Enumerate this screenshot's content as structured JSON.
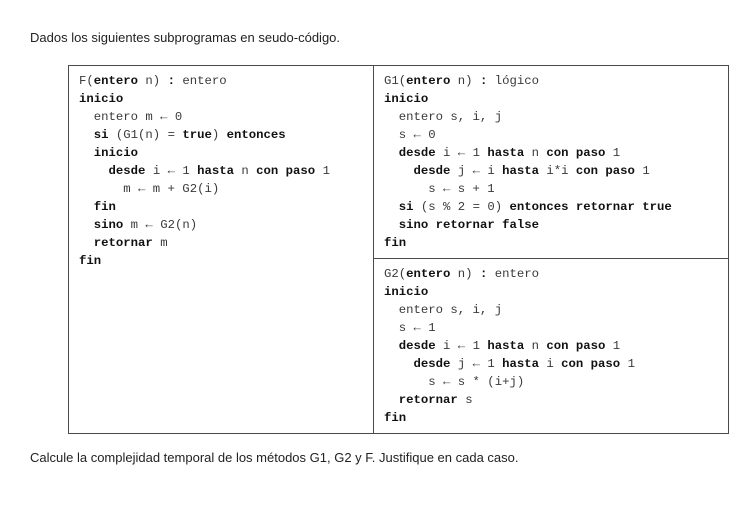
{
  "intro": "Dados los siguientes subprogramas en seudo-código.",
  "outro": "Calcule la complejidad temporal de los métodos G1, G2 y F. Justifique en cada caso.",
  "cells": {
    "F": {
      "lines": [
        [
          [
            "p",
            "F("
          ],
          [
            "b",
            "entero"
          ],
          [
            "p",
            " n) "
          ],
          [
            "b",
            ":"
          ],
          [
            "p",
            " entero"
          ]
        ],
        [
          [
            "b",
            "inicio"
          ]
        ],
        [
          [
            "p",
            "  entero m ← 0"
          ]
        ],
        [
          [
            "p",
            "  "
          ],
          [
            "b",
            "si"
          ],
          [
            "p",
            " (G1(n) = "
          ],
          [
            "b",
            "true"
          ],
          [
            "p",
            ") "
          ],
          [
            "b",
            "entonces"
          ]
        ],
        [
          [
            "p",
            "  "
          ],
          [
            "b",
            "inicio"
          ]
        ],
        [
          [
            "p",
            "    "
          ],
          [
            "b",
            "desde"
          ],
          [
            "p",
            " i ← 1 "
          ],
          [
            "b",
            "hasta"
          ],
          [
            "p",
            " n "
          ],
          [
            "b",
            "con paso"
          ],
          [
            "p",
            " 1"
          ]
        ],
        [
          [
            "p",
            "      m ← m + G2(i)"
          ]
        ],
        [
          [
            "p",
            "  "
          ],
          [
            "b",
            "fin"
          ]
        ],
        [
          [
            "p",
            "  "
          ],
          [
            "b",
            "sino"
          ],
          [
            "p",
            " m ← G2(n)"
          ]
        ],
        [
          [
            "p",
            "  "
          ],
          [
            "b",
            "retornar"
          ],
          [
            "p",
            " m"
          ]
        ],
        [
          [
            "b",
            "fin"
          ]
        ]
      ]
    },
    "G1": {
      "lines": [
        [
          [
            "p",
            "G1("
          ],
          [
            "b",
            "entero"
          ],
          [
            "p",
            " n) "
          ],
          [
            "b",
            ":"
          ],
          [
            "p",
            " lógico"
          ]
        ],
        [
          [
            "b",
            "inicio"
          ]
        ],
        [
          [
            "p",
            "  entero s, i, j"
          ]
        ],
        [
          [
            "p",
            "  s ← 0"
          ]
        ],
        [
          [
            "p",
            "  "
          ],
          [
            "b",
            "desde"
          ],
          [
            "p",
            " i ← 1 "
          ],
          [
            "b",
            "hasta"
          ],
          [
            "p",
            " n "
          ],
          [
            "b",
            "con paso"
          ],
          [
            "p",
            " 1"
          ]
        ],
        [
          [
            "p",
            "    "
          ],
          [
            "b",
            "desde"
          ],
          [
            "p",
            " j ← i "
          ],
          [
            "b",
            "hasta"
          ],
          [
            "p",
            " i*i "
          ],
          [
            "b",
            "con paso"
          ],
          [
            "p",
            " 1"
          ]
        ],
        [
          [
            "p",
            "      s ← s + 1"
          ]
        ],
        [
          [
            "p",
            "  "
          ],
          [
            "b",
            "si"
          ],
          [
            "p",
            " (s % 2 = 0) "
          ],
          [
            "b",
            "entonces retornar true"
          ]
        ],
        [
          [
            "p",
            "  "
          ],
          [
            "b",
            "sino retornar false"
          ]
        ],
        [
          [
            "b",
            "fin"
          ]
        ]
      ]
    },
    "G2": {
      "lines": [
        [
          [
            "p",
            "G2("
          ],
          [
            "b",
            "entero"
          ],
          [
            "p",
            " n) "
          ],
          [
            "b",
            ":"
          ],
          [
            "p",
            " entero"
          ]
        ],
        [
          [
            "b",
            "inicio"
          ]
        ],
        [
          [
            "p",
            "  entero s, i, j"
          ]
        ],
        [
          [
            "p",
            "  s ← 1"
          ]
        ],
        [
          [
            "p",
            "  "
          ],
          [
            "b",
            "desde"
          ],
          [
            "p",
            " i ← 1 "
          ],
          [
            "b",
            "hasta"
          ],
          [
            "p",
            " n "
          ],
          [
            "b",
            "con paso"
          ],
          [
            "p",
            " 1"
          ]
        ],
        [
          [
            "p",
            "    "
          ],
          [
            "b",
            "desde"
          ],
          [
            "p",
            " j ← 1 "
          ],
          [
            "b",
            "hasta"
          ],
          [
            "p",
            " i "
          ],
          [
            "b",
            "con paso"
          ],
          [
            "p",
            " 1"
          ]
        ],
        [
          [
            "p",
            "      s ← s * (i+j)"
          ]
        ],
        [
          [
            "p",
            "  "
          ],
          [
            "b",
            "retornar"
          ],
          [
            "p",
            " s"
          ]
        ],
        [
          [
            "b",
            "fin"
          ]
        ]
      ]
    }
  }
}
